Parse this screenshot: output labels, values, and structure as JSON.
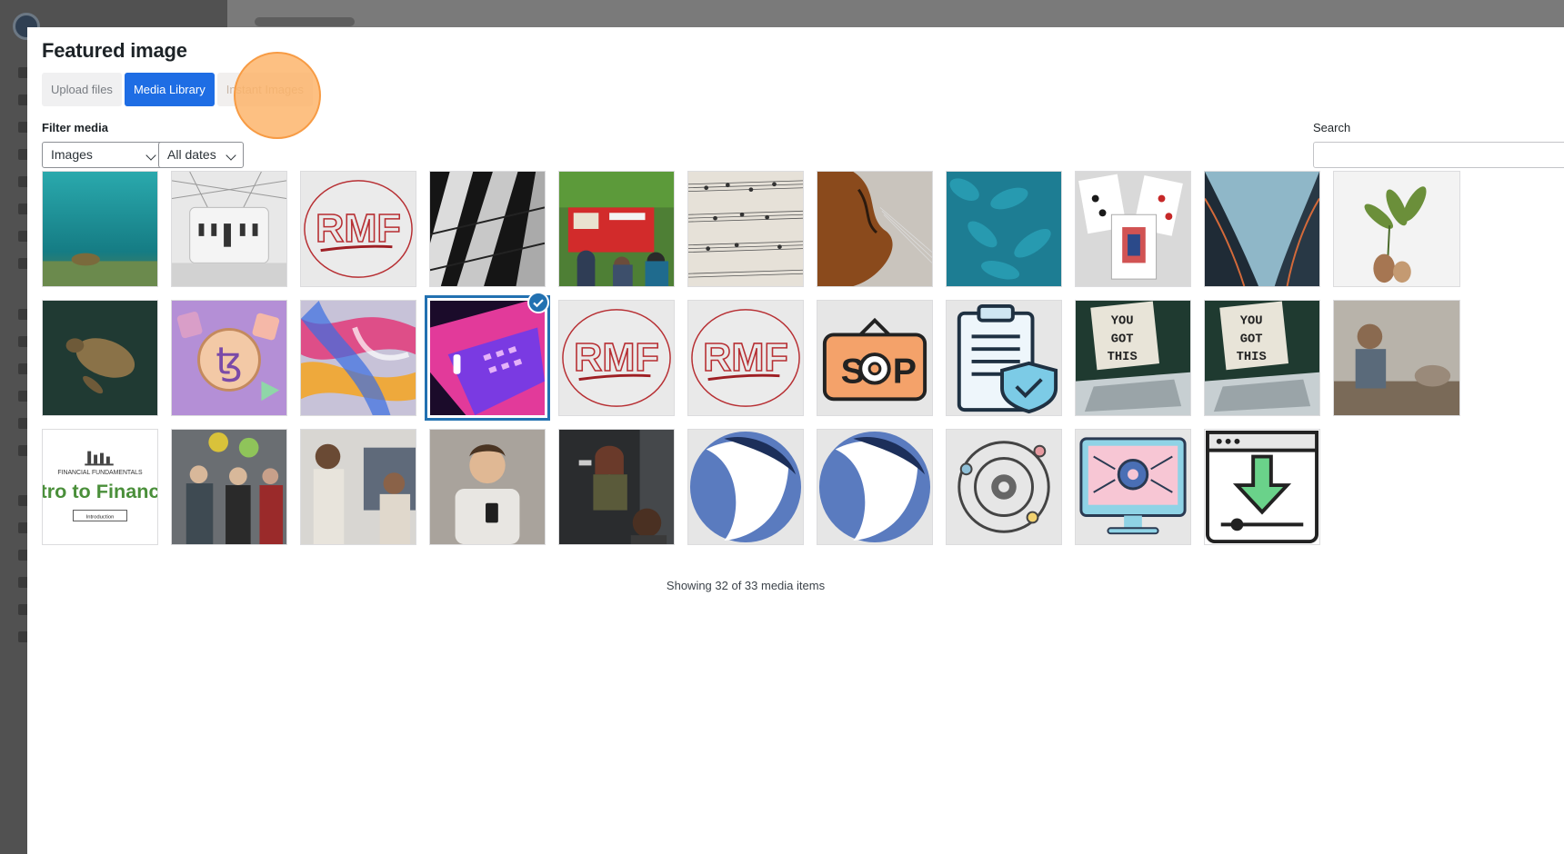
{
  "modal": {
    "title": "Featured image",
    "tabs": [
      {
        "label": "Upload files",
        "active": false
      },
      {
        "label": "Media Library",
        "active": true
      },
      {
        "label": "Instant Images",
        "active": false
      }
    ]
  },
  "filter": {
    "label": "Filter media",
    "type_value": "Images",
    "date_value": "All dates"
  },
  "search": {
    "label": "Search",
    "value": ""
  },
  "media_items": [
    {
      "name": "sea-turtle-seagrass"
    },
    {
      "name": "glass-roof-courtyard"
    },
    {
      "name": "rmf-logo"
    },
    {
      "name": "light-on-tiled-floor"
    },
    {
      "name": "fire-truck-crowd"
    },
    {
      "name": "sheet-music"
    },
    {
      "name": "violin"
    },
    {
      "name": "teal-feathers"
    },
    {
      "name": "playing-cards"
    },
    {
      "name": "curved-building"
    },
    {
      "name": "plant-in-vase"
    },
    {
      "name": "sea-turtle-dark-water"
    },
    {
      "name": "tezos-coin"
    },
    {
      "name": "colorful-abstract"
    },
    {
      "name": "laptop-neon-keyboard",
      "selected": true
    },
    {
      "name": "rmf-logo-2"
    },
    {
      "name": "rmf-logo-3"
    },
    {
      "name": "sop-sign-icon"
    },
    {
      "name": "clipboard-shield-icon"
    },
    {
      "name": "you-got-this-lightbox"
    },
    {
      "name": "you-got-this-lightbox-2"
    },
    {
      "name": "man-at-desk"
    },
    {
      "name": "financial-fundamentals-slide",
      "text": [
        "FINANCIAL FUNDAMENTALS",
        "tro to Financ",
        "Introduction"
      ]
    },
    {
      "name": "office-party-balloons"
    },
    {
      "name": "women-in-office"
    },
    {
      "name": "man-with-phone"
    },
    {
      "name": "woman-with-flashlight"
    },
    {
      "name": "blue-circle-logo"
    },
    {
      "name": "blue-circle-logo-2"
    },
    {
      "name": "gear-orbit-icon"
    },
    {
      "name": "monitor-gear-icon"
    },
    {
      "name": "download-window-icon"
    }
  ],
  "status": {
    "count_text": "Showing 32 of 33 media items"
  },
  "colors": {
    "accent": "#1e6de4",
    "selected_border": "#2271b1",
    "highlight": "#fdb266"
  }
}
